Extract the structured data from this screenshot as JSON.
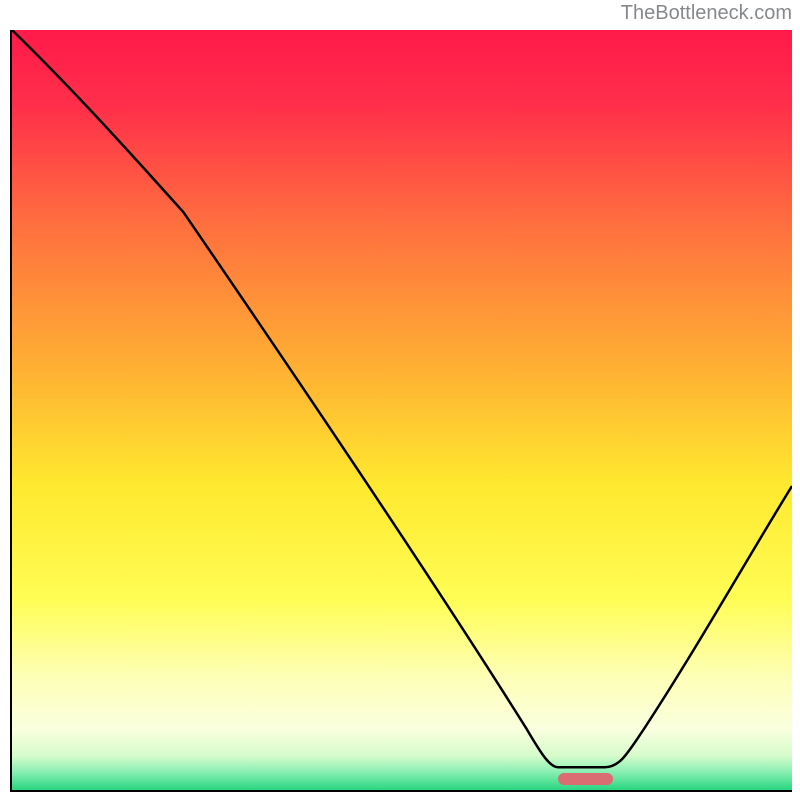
{
  "watermark": "TheBottleneck.com",
  "chart_data": {
    "type": "line",
    "title": "",
    "xlabel": "",
    "ylabel": "",
    "xlim": [
      0,
      100
    ],
    "ylim": [
      0,
      100
    ],
    "x": [
      0,
      22,
      70,
      76,
      100
    ],
    "values": [
      100,
      76,
      3,
      3,
      40
    ],
    "marker": {
      "x_start": 70,
      "x_end": 77,
      "y": 1.5
    },
    "gradient_stops": [
      {
        "offset": 0.0,
        "color": "#ff1a4a"
      },
      {
        "offset": 0.1,
        "color": "#ff2f4a"
      },
      {
        "offset": 0.25,
        "color": "#ff6d3f"
      },
      {
        "offset": 0.45,
        "color": "#ffb233"
      },
      {
        "offset": 0.6,
        "color": "#ffe92f"
      },
      {
        "offset": 0.75,
        "color": "#fffd55"
      },
      {
        "offset": 0.85,
        "color": "#feffb5"
      },
      {
        "offset": 0.92,
        "color": "#faffdf"
      },
      {
        "offset": 0.955,
        "color": "#d6fccb"
      },
      {
        "offset": 0.975,
        "color": "#8ef0b5"
      },
      {
        "offset": 1.0,
        "color": "#28d67f"
      }
    ]
  }
}
